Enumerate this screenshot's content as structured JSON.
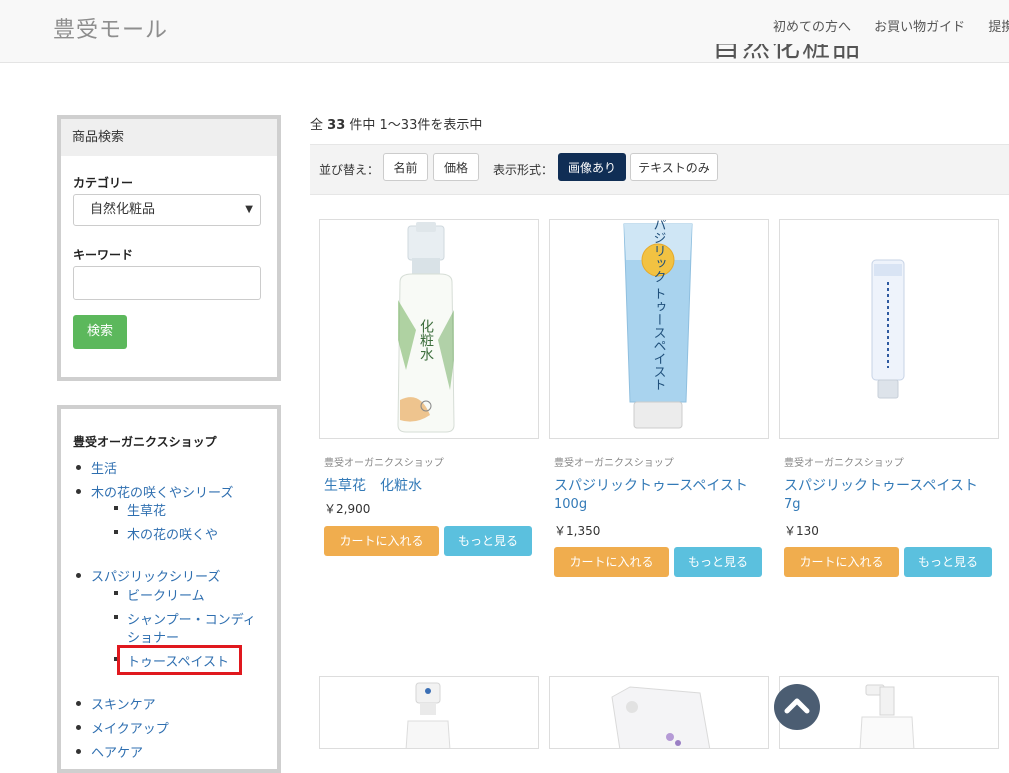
{
  "header": {
    "logo": "豊受モール",
    "nav": [
      "初めての方へ",
      "お買い物ガイド",
      "提携施設"
    ]
  },
  "page_title": "自然化粧品",
  "sidebar": {
    "search": {
      "heading": "商品検索",
      "category_label": "カテゴリー",
      "category_value": "自然化粧品",
      "keyword_label": "キーワード",
      "keyword_value": "",
      "search_button": "検索"
    },
    "categories": {
      "title": "豊受オーガニクスショップ",
      "items": [
        {
          "label": "生活"
        },
        {
          "label": "木の花の咲くやシリーズ",
          "children": [
            "生草花",
            "木の花の咲くや"
          ]
        },
        {
          "label": "スパジリックシリーズ",
          "children": [
            "ビークリーム",
            "シャンプー・コンディ",
            "ショナー",
            "トゥースペイスト"
          ]
        },
        {
          "label": "スキンケア"
        },
        {
          "label": "メイクアップ"
        },
        {
          "label": "ヘアケア"
        }
      ]
    }
  },
  "results": {
    "count_prefix": "全",
    "count": "33",
    "count_suffix": "件中 1〜33件を表示中"
  },
  "toolbar": {
    "sort_label": "並び替え：",
    "sort_name": "名前",
    "sort_price": "価格",
    "view_label": "表示形式：",
    "view_image": "画像あり",
    "view_text": "テキストのみ"
  },
  "products": [
    {
      "shop": "豊受オーガニクスショップ",
      "name": "生草花　化粧水",
      "sub": "",
      "price": "￥2,900",
      "cart": "カートに入れる",
      "more": "もっと見る",
      "bottle_text": "化粧水"
    },
    {
      "shop": "豊受オーガニクスショップ",
      "name": "スパジリックトゥースペイスト",
      "sub": "100g",
      "price": "￥1,350",
      "cart": "カートに入れる",
      "more": "もっと見る",
      "tube_text": "スパジリック トゥースペイスト"
    },
    {
      "shop": "豊受オーガニクスショップ",
      "name": "スパジリックトゥースペイスト",
      "sub": "7g",
      "price": "￥130",
      "cart": "カートに入れる",
      "more": "もっと見る"
    }
  ],
  "colors": {
    "accent_green": "#5cb85c",
    "cart_orange": "#f0ad4e",
    "more_blue": "#5bc0de",
    "active_navy": "#102e55",
    "highlight_red": "#e0181e"
  }
}
